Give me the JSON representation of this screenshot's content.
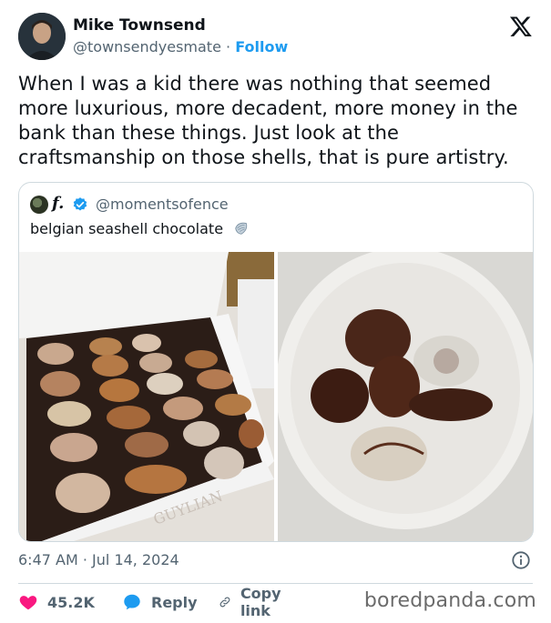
{
  "author": {
    "name": "Mike Townsend",
    "handle": "@townsendyesmate",
    "separator": "·",
    "follow_label": "Follow"
  },
  "tweet": {
    "text": "When I was a kid there was nothing that seemed more luxurious, more decadent, more money in the bank than these things. Just look at the craftsmanship on those shells, that is pure artistry."
  },
  "quoted": {
    "name": "f.",
    "handle": "@momentsofence",
    "text": "belgian seashell chocolate",
    "box_label": "GUYLIAN"
  },
  "meta": {
    "time": "6:47 AM",
    "separator": "·",
    "date": "Jul 14, 2024"
  },
  "actions": {
    "likes": "45.2K",
    "reply_label": "Reply",
    "copy_label": "Copy link"
  },
  "watermark": "boredpanda.com",
  "colors": {
    "accent": "#1d9bf0",
    "like": "#f91880",
    "text": "#0f1419",
    "muted": "#536471",
    "border": "#cfd9de"
  },
  "icons": [
    "x-logo",
    "verified-badge",
    "shell-emoji",
    "info-icon",
    "heart-icon",
    "reply-bubble-icon",
    "link-icon"
  ]
}
